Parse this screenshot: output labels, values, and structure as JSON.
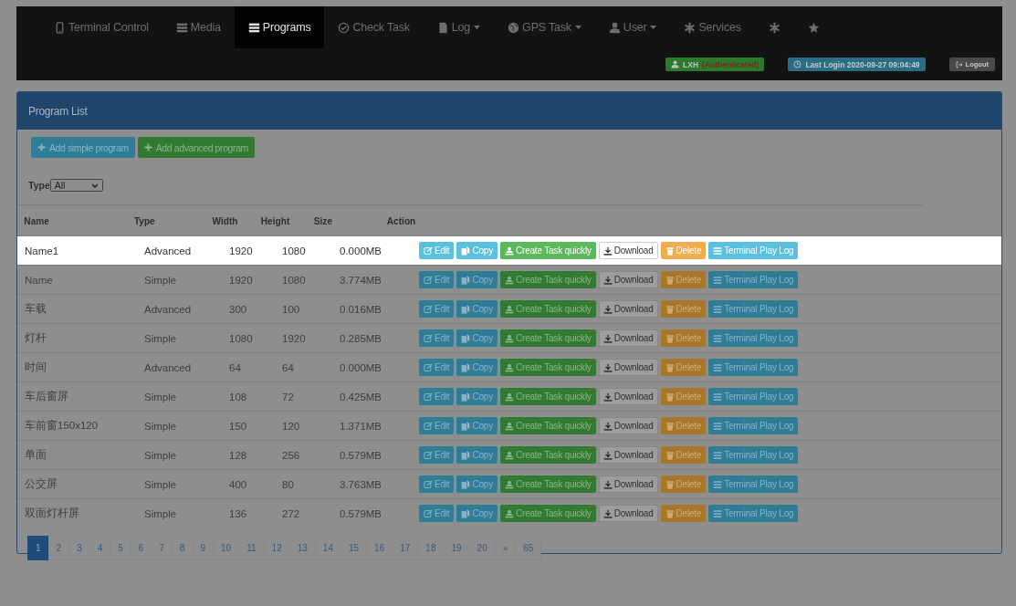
{
  "navbar": {
    "items": [
      {
        "kind": "phone",
        "label": "Terminal Control",
        "selected": false,
        "dropdown": false
      },
      {
        "kind": "list",
        "label": "Media",
        "selected": false,
        "dropdown": false
      },
      {
        "kind": "list",
        "label": "Programs",
        "selected": true,
        "dropdown": false
      },
      {
        "kind": "check",
        "label": "Check Task",
        "selected": false,
        "dropdown": false
      },
      {
        "kind": "file",
        "label": "Log",
        "selected": false,
        "dropdown": true
      },
      {
        "kind": "globe",
        "label": "GPS Task",
        "selected": false,
        "dropdown": true
      },
      {
        "kind": "user",
        "label": "User",
        "selected": false,
        "dropdown": true
      },
      {
        "kind": "asterisk",
        "label": "Services",
        "selected": false,
        "dropdown": false
      },
      {
        "kind": "asterisk",
        "selected": false,
        "dropdown": false
      },
      {
        "kind": "star",
        "selected": false,
        "dropdown": false
      }
    ],
    "user": {
      "name": "LXH",
      "status": "(Authenticated)"
    },
    "last_login": "Last Login 2020-09-27 09:04:49",
    "logout": "Logout"
  },
  "panel": {
    "title": "Program List",
    "buttons": [
      {
        "kind": "info",
        "label": "Add simple program"
      },
      {
        "kind": "success",
        "label": "Add advanced program"
      }
    ],
    "filter": {
      "label": "Type",
      "value": "All"
    },
    "table": {
      "columns": [
        "Name",
        "Type",
        "Width",
        "Height",
        "Size",
        "Action"
      ],
      "rows": [
        {
          "selected": true,
          "cells": [
            "Name1",
            "Advanced",
            "1920",
            "1080",
            "0.000MB"
          ],
          "actions": [
            {
              "kind": "edit",
              "label": "Edit"
            },
            {
              "kind": "copy",
              "label": "Copy"
            },
            {
              "kind": "task",
              "label": "Create Task quickly"
            },
            {
              "kind": "download",
              "label": "Download"
            },
            {
              "kind": "delete",
              "label": "Delete"
            },
            {
              "kind": "log",
              "label": "Terminal Play Log"
            }
          ]
        },
        {
          "selected": false,
          "cells": [
            "Name",
            "Simple",
            "1920",
            "1080",
            "3.774MB"
          ],
          "actions": [
            {
              "kind": "edit",
              "label": "Edit"
            },
            {
              "kind": "copy",
              "label": "Copy"
            },
            {
              "kind": "task",
              "label": "Create Task quickly"
            },
            {
              "kind": "download",
              "label": "Download"
            },
            {
              "kind": "delete",
              "label": "Delete"
            },
            {
              "kind": "log",
              "label": "Terminal Play Log"
            }
          ]
        },
        {
          "selected": false,
          "cells": [
            "车载",
            "Advanced",
            "300",
            "100",
            "0.016MB"
          ],
          "actions": [
            {
              "kind": "edit",
              "label": "Edit"
            },
            {
              "kind": "copy",
              "label": "Copy"
            },
            {
              "kind": "task",
              "label": "Create Task quickly"
            },
            {
              "kind": "download",
              "label": "Download"
            },
            {
              "kind": "delete",
              "label": "Delete"
            },
            {
              "kind": "log",
              "label": "Terminal Play Log"
            }
          ]
        },
        {
          "selected": false,
          "cells": [
            "灯杆",
            "Simple",
            "1080",
            "1920",
            "0.285MB"
          ],
          "actions": [
            {
              "kind": "edit",
              "label": "Edit"
            },
            {
              "kind": "copy",
              "label": "Copy"
            },
            {
              "kind": "task",
              "label": "Create Task quickly"
            },
            {
              "kind": "download",
              "label": "Download"
            },
            {
              "kind": "delete",
              "label": "Delete"
            },
            {
              "kind": "log",
              "label": "Terminal Play Log"
            }
          ]
        },
        {
          "selected": false,
          "cells": [
            "时间",
            "Advanced",
            "64",
            "64",
            "0.000MB"
          ],
          "actions": [
            {
              "kind": "edit",
              "label": "Edit"
            },
            {
              "kind": "copy",
              "label": "Copy"
            },
            {
              "kind": "task",
              "label": "Create Task quickly"
            },
            {
              "kind": "download",
              "label": "Download"
            },
            {
              "kind": "delete",
              "label": "Delete"
            },
            {
              "kind": "log",
              "label": "Terminal Play Log"
            }
          ]
        },
        {
          "selected": false,
          "cells": [
            "车后窗屏",
            "Simple",
            "108",
            "72",
            "0.425MB"
          ],
          "actions": [
            {
              "kind": "edit",
              "label": "Edit"
            },
            {
              "kind": "copy",
              "label": "Copy"
            },
            {
              "kind": "task",
              "label": "Create Task quickly"
            },
            {
              "kind": "download",
              "label": "Download"
            },
            {
              "kind": "delete",
              "label": "Delete"
            },
            {
              "kind": "log",
              "label": "Terminal Play Log"
            }
          ]
        },
        {
          "selected": false,
          "cells": [
            "车前窗150x120",
            "Simple",
            "150",
            "120",
            "1.371MB"
          ],
          "actions": [
            {
              "kind": "edit",
              "label": "Edit"
            },
            {
              "kind": "copy",
              "label": "Copy"
            },
            {
              "kind": "task",
              "label": "Create Task quickly"
            },
            {
              "kind": "download",
              "label": "Download"
            },
            {
              "kind": "delete",
              "label": "Delete"
            },
            {
              "kind": "log",
              "label": "Terminal Play Log"
            }
          ]
        },
        {
          "selected": false,
          "cells": [
            "单面",
            "Simple",
            "128",
            "256",
            "0.579MB"
          ],
          "actions": [
            {
              "kind": "edit",
              "label": "Edit"
            },
            {
              "kind": "copy",
              "label": "Copy"
            },
            {
              "kind": "task",
              "label": "Create Task quickly"
            },
            {
              "kind": "download",
              "label": "Download"
            },
            {
              "kind": "delete",
              "label": "Delete"
            },
            {
              "kind": "log",
              "label": "Terminal Play Log"
            }
          ]
        },
        {
          "selected": false,
          "cells": [
            "公交屏",
            "Simple",
            "400",
            "80",
            "3.763MB"
          ],
          "actions": [
            {
              "kind": "edit",
              "label": "Edit"
            },
            {
              "kind": "copy",
              "label": "Copy"
            },
            {
              "kind": "task",
              "label": "Create Task quickly"
            },
            {
              "kind": "download",
              "label": "Download"
            },
            {
              "kind": "delete",
              "label": "Delete"
            },
            {
              "kind": "log",
              "label": "Terminal Play Log"
            }
          ]
        },
        {
          "selected": false,
          "cells": [
            "双面灯杆屏",
            "Simple",
            "136",
            "272",
            "0.579MB"
          ],
          "actions": [
            {
              "kind": "edit",
              "label": "Edit"
            },
            {
              "kind": "copy",
              "label": "Copy"
            },
            {
              "kind": "task",
              "label": "Create Task quickly"
            },
            {
              "kind": "download",
              "label": "Download"
            },
            {
              "kind": "delete",
              "label": "Delete"
            },
            {
              "kind": "log",
              "label": "Terminal Play Log"
            }
          ]
        }
      ]
    },
    "pagination": [
      {
        "label": "1",
        "selected": true
      },
      {
        "label": "2",
        "selected": false
      },
      {
        "label": "3",
        "selected": false
      },
      {
        "label": "4",
        "selected": false
      },
      {
        "label": "5",
        "selected": false
      },
      {
        "label": "6",
        "selected": false
      },
      {
        "label": "7",
        "selected": false
      },
      {
        "label": "8",
        "selected": false
      },
      {
        "label": "9",
        "selected": false
      },
      {
        "label": "10",
        "selected": false
      },
      {
        "label": "11",
        "selected": false
      },
      {
        "label": "12",
        "selected": false
      },
      {
        "label": "13",
        "selected": false
      },
      {
        "label": "14",
        "selected": false
      },
      {
        "label": "15",
        "selected": false
      },
      {
        "label": "16",
        "selected": false
      },
      {
        "label": "17",
        "selected": false
      },
      {
        "label": "18",
        "selected": false
      },
      {
        "label": "19",
        "selected": false
      },
      {
        "label": "20",
        "selected": false
      },
      {
        "label": "»",
        "selected": false
      },
      {
        "label": "65",
        "selected": false
      }
    ]
  }
}
